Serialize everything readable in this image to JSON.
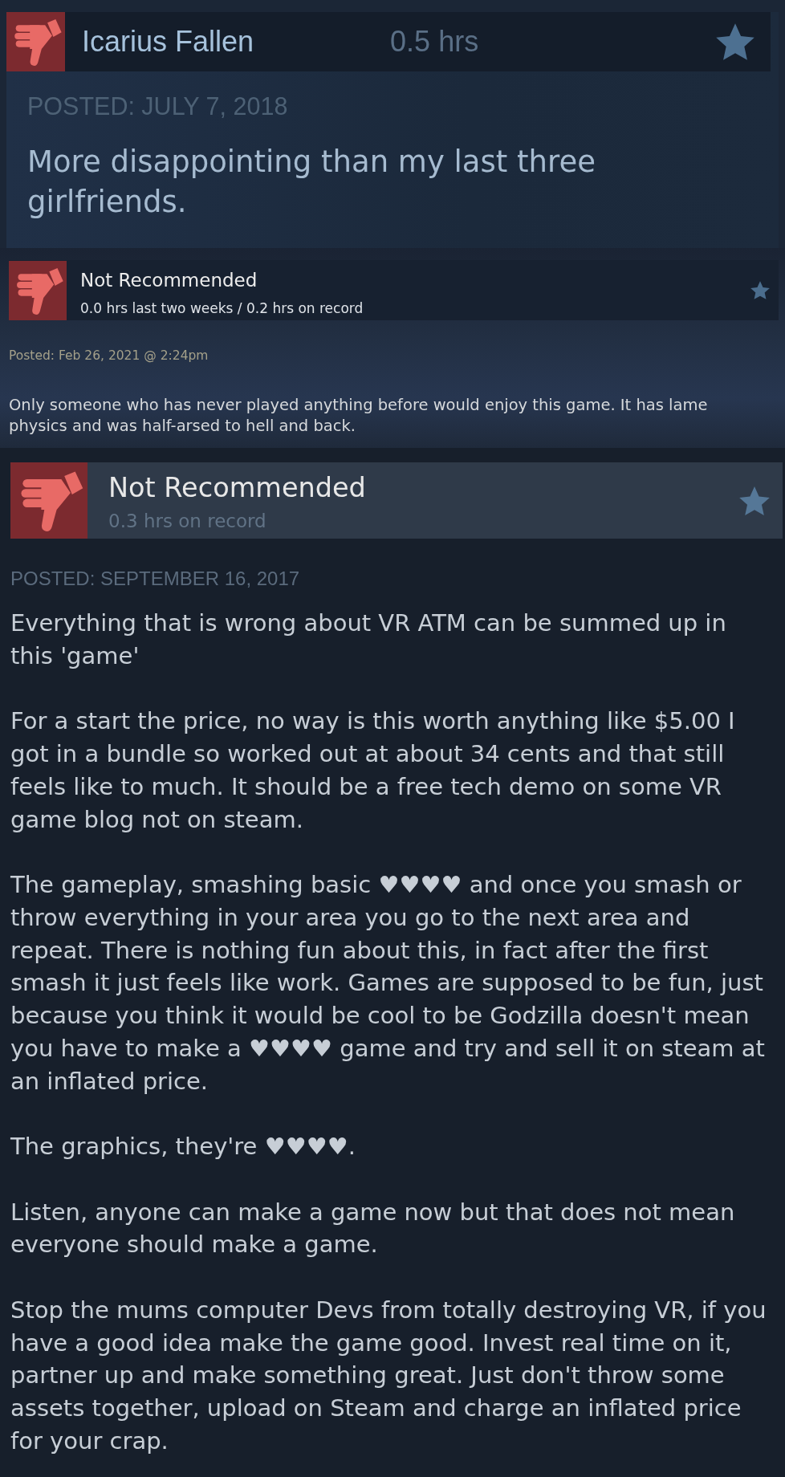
{
  "reviews": [
    {
      "kind": "card",
      "recommended": false,
      "title": "Icarius Fallen",
      "hours": "0.5 hrs",
      "posted": "POSTED: JULY 7, 2018",
      "paragraphs": [
        "More disappointing than my last three girlfriends."
      ]
    },
    {
      "kind": "strip",
      "recommended": false,
      "title": "Not Recommended",
      "hours": "0.0 hrs last two weeks / 0.2 hrs on record",
      "posted": "Posted: Feb 26, 2021 @ 2:24pm",
      "paragraphs": [
        "Only someone who has never played anything before would enjoy this game. It has lame physics and was half-arsed to hell and back."
      ]
    },
    {
      "kind": "full",
      "recommended": false,
      "title": "Not Recommended",
      "hours": "0.3 hrs on record",
      "posted": "POSTED: SEPTEMBER 16, 2017",
      "paragraphs": [
        "Everything that is wrong about VR ATM can be summed up in this 'game'",
        "For a start the price, no way is this worth anything like $5.00 I got in a bundle so worked out at about 34 cents and that still feels like to much. It should be a free tech demo on some VR game blog not on steam.",
        "The gameplay, smashing basic ♥♥♥♥ and once you smash or throw everything in your area you go to the next area and repeat. There is nothing fun about this, in fact after the first smash it just feels like work. Games are supposed to be fun, just because you think it would be cool to be Godzilla doesn't mean you have to make a ♥♥♥♥ game and try and sell it on steam at an inflated price.",
        "The graphics, they're ♥♥♥♥.",
        "Listen, anyone can make a game now but that does not mean everyone should make a game.",
        "Stop the mums computer Devs from totally destroying VR, if you have a good idea make the game good. Invest real time on it, partner up and make something great. Just don't throw some assets together, upload on Steam and charge an inflated price for your crap."
      ]
    }
  ]
}
